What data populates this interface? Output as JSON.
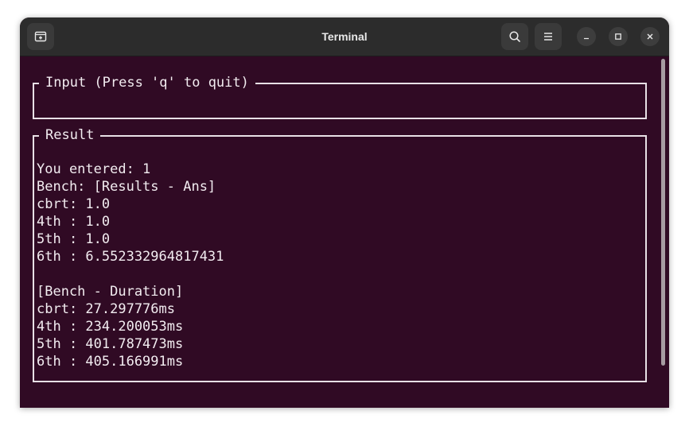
{
  "window": {
    "title": "Terminal"
  },
  "titlebar_icons": {
    "new_tab": "new-tab-icon",
    "search": "search-icon",
    "menu": "hamburger-menu-icon",
    "minimize": "minimize-icon",
    "maximize": "maximize-icon",
    "close": "close-icon"
  },
  "colors": {
    "terminal_background": "#300a24",
    "terminal_text": "#f2ecf0",
    "titlebar": "#2c2c2c"
  },
  "input_box": {
    "title": "Input (Press 'q' to quit)",
    "value": ""
  },
  "result_box": {
    "title": "Result",
    "lines": [
      "You entered: 1",
      "Bench: [Results - Ans]",
      "cbrt: 1.0",
      "4th : 1.0",
      "5th : 1.0",
      "6th : 6.552332964817431",
      "",
      "[Bench - Duration]",
      "cbrt: 27.297776ms",
      "4th : 234.200053ms",
      "5th : 401.787473ms",
      "6th : 405.166991ms"
    ]
  }
}
